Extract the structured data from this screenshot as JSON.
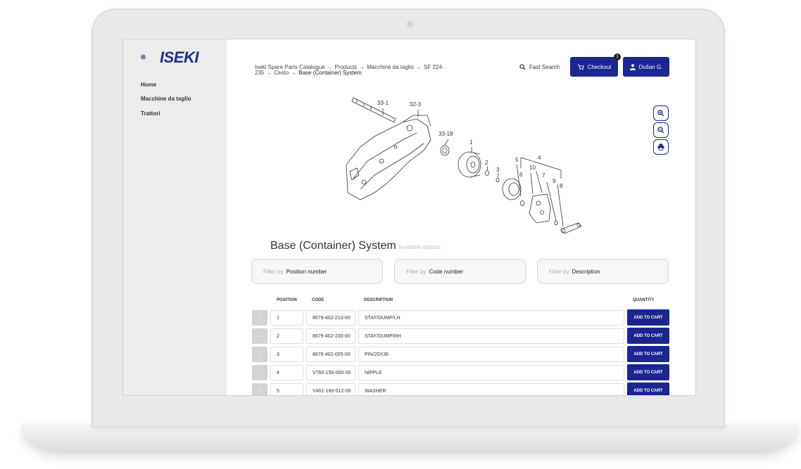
{
  "sidebar": {
    "logo_text": "ISEKI",
    "items": [
      {
        "label": "Home"
      },
      {
        "label": "Macchine da taglio"
      },
      {
        "label": "Trattori"
      }
    ]
  },
  "breadcrumb": {
    "items": [
      "Iseki Spare Parts Catalogue",
      "Products",
      "Macchine da taglio",
      "SF 224-235",
      "Cesto"
    ],
    "current": "Base (Container) System"
  },
  "header": {
    "fast_search": "Fast Search",
    "checkout": "Checkout",
    "cart_count": "1",
    "user": "Dušan G."
  },
  "diagram_labels": [
    "33-1",
    "32-3",
    "33-18",
    "1",
    "2",
    "3",
    "5",
    "4",
    "10",
    "6",
    "7",
    "9",
    "8"
  ],
  "page": {
    "title": "Base (Container) System",
    "subtitle": "Available options"
  },
  "filters": [
    {
      "label": "Filter by",
      "value": "Position number"
    },
    {
      "label": "Filter by",
      "value": "Code number"
    },
    {
      "label": "Filter by",
      "value": "Description"
    }
  ],
  "table": {
    "headers": {
      "position": "POSITION",
      "code": "CODE",
      "description": "DESCRIPTION",
      "quantity": "QUANTITY"
    },
    "add_label": "ADD TO CART",
    "rows": [
      {
        "position": "1",
        "code": "8679-402-210-00",
        "description": "STAY/DUMP/LH"
      },
      {
        "position": "2",
        "code": "8679-402-230-00",
        "description": "STAY/DUMP/RH"
      },
      {
        "position": "3",
        "code": "8676-402-005-00",
        "description": "PIN/20X36"
      },
      {
        "position": "4",
        "code": "V760-150-000-00",
        "description": "NIPPLE"
      },
      {
        "position": "5",
        "code": "V401-160-012-00",
        "description": "WASHER"
      }
    ]
  },
  "colors": {
    "brand": "#1c2590",
    "sidebar": "#ececec"
  }
}
